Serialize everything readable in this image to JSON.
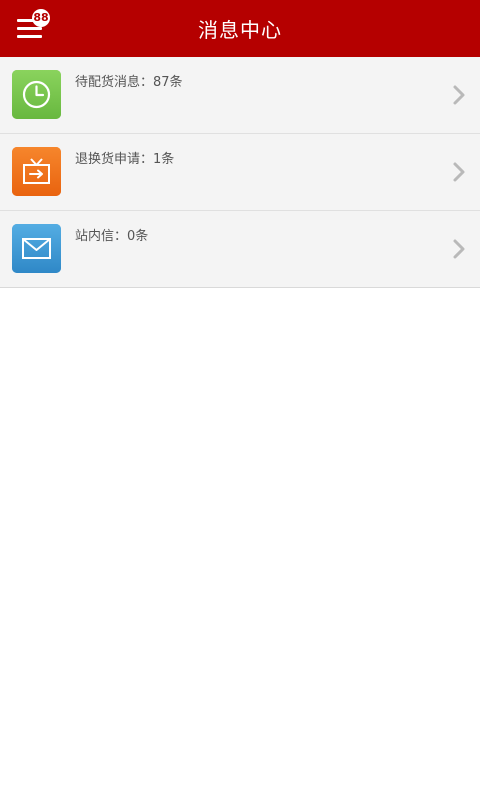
{
  "header": {
    "title": "消息中心",
    "badge_count": "88"
  },
  "messages": [
    {
      "label": "待配货消息：87条",
      "icon": "clock-icon",
      "color": "#7cc752"
    },
    {
      "label": "退换货申请：1条",
      "icon": "return-box-icon",
      "color": "#f0751e"
    },
    {
      "label": "站内信：0条",
      "icon": "envelope-icon",
      "color": "#3f9bd6"
    }
  ]
}
